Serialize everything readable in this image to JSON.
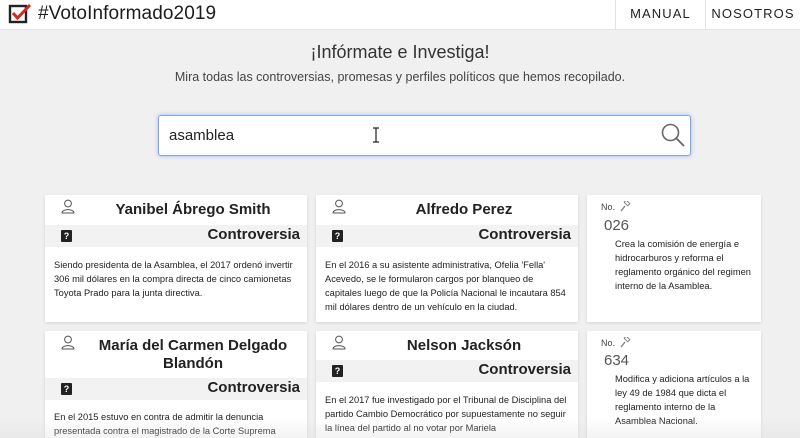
{
  "navbar": {
    "brand": "#VotoInformado2019",
    "links": [
      "MANUAL",
      "NOSOTROS"
    ]
  },
  "hero": {
    "title": "¡Infórmate e Investiga!",
    "subtitle": "Mira todas las controversias, promesas y perfiles políticos que hemos recopilado."
  },
  "search": {
    "value": "asamblea"
  },
  "cards": [
    {
      "name": "Yanibel Ábrego Smith",
      "type": "Controversia",
      "description": "Siendo presidenta de la Asamblea, el 2017 ordenó invertir 306 mil dólares en la compra directa de cinco camionetas Toyota Prado para la junta directiva."
    },
    {
      "name": "Alfredo Perez",
      "type": "Controversia",
      "description": "En el 2016 a su asistente administrativa, Ofelia 'Fella' Acevedo, se le formularon cargos por blanqueo de capitales luego de que la Policía Nacional le incautara 854 mil dólares dentro de un vehículo en la ciudad."
    },
    {
      "name": "María del Carmen Delgado Blandón",
      "type": "Controversia",
      "description": "En el 2015 estuvo en contra de admitir la denuncia presentada contra el magistrado de la Corte Suprema"
    },
    {
      "name": "Nelson Jacksón",
      "type": "Controversia",
      "description": "En el 2017 fue investigado por el Tribunal de Disciplina del partido Cambio Democrático por supuestamente no seguir la línea del partido al no votar por Mariela"
    }
  ],
  "laws": [
    {
      "label": "No.",
      "number": "026",
      "description": "Crea la comisión de energía e hidrocarburos y reforma el reglamento orgánico del regimen interno de la Asamblea."
    },
    {
      "label": "No.",
      "number": "634",
      "description": "Modifica y adiciona artículos a la ley 49 de 1984 que dicta el reglamento interno de la Asamblea Nacional."
    }
  ]
}
